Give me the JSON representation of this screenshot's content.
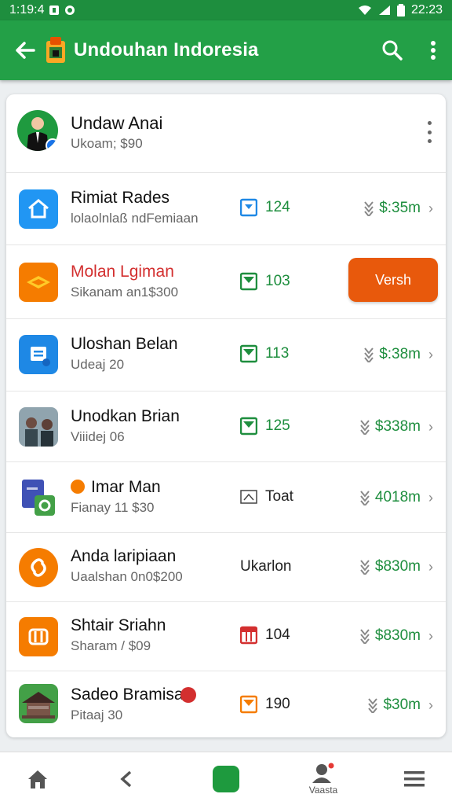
{
  "status_bar": {
    "time_left": "1:19:4",
    "time_right": "22:23"
  },
  "app_bar": {
    "title": "Undouhan Indoresia"
  },
  "profile": {
    "name": "Undaw Anai",
    "subtitle": "Ukoam; $90"
  },
  "items": [
    {
      "title": "Rimiat Rades",
      "subtitle": "lolaolnlaß ndFemiaan",
      "stat": "124",
      "price": "$:35m",
      "icon": "home-icon",
      "color": "#2196f3",
      "title_color": "#111"
    },
    {
      "title": "Molan Lgiman",
      "subtitle": "Sikanam an1$300",
      "stat": "103",
      "price": "",
      "button": "Versh",
      "icon": "diamond-icon",
      "color": "#f57c00",
      "title_color": "#d32f2f"
    },
    {
      "title": "Uloshan Belan",
      "subtitle": "Udeaj 20",
      "stat": "113",
      "price": "$:38m",
      "icon": "document-icon",
      "color": "#1e88e5",
      "title_color": "#111"
    },
    {
      "title": "Unodkan Brian",
      "subtitle": "Viiidej 06",
      "stat": "125",
      "price": "$338m",
      "icon": "photo-thumbnail",
      "color": "#8d6e63",
      "title_color": "#111"
    },
    {
      "title": "Imar Man",
      "subtitle": "Fianay 11 $30",
      "stat": "Toat",
      "price": "4018m",
      "icon": "file-copy-icon",
      "color": "#3f51b5",
      "title_color": "#111"
    },
    {
      "title": "Anda laripiaan",
      "subtitle": "Uaalshan 0n0$200",
      "stat": "Ukarlon",
      "price": "$830m",
      "icon": "link-icon",
      "color": "#f57c00",
      "title_color": "#111"
    },
    {
      "title": "Shtair Sriahn",
      "subtitle": "Sharam / $09",
      "stat": "104",
      "price": "$830m",
      "icon": "grid-icon",
      "color": "#f57c00",
      "title_color": "#111"
    },
    {
      "title": "Sadeo Bramisa",
      "subtitle": "Pitaaj 30",
      "stat": "190",
      "price": "$30m",
      "icon": "house-icon",
      "color": "#43a047",
      "title_color": "#111"
    }
  ],
  "bottom_nav": {
    "profile_label": "Vaasta"
  },
  "colors": {
    "primary": "#23a047",
    "status": "#1e8e3e",
    "accent": "#e8590c"
  }
}
